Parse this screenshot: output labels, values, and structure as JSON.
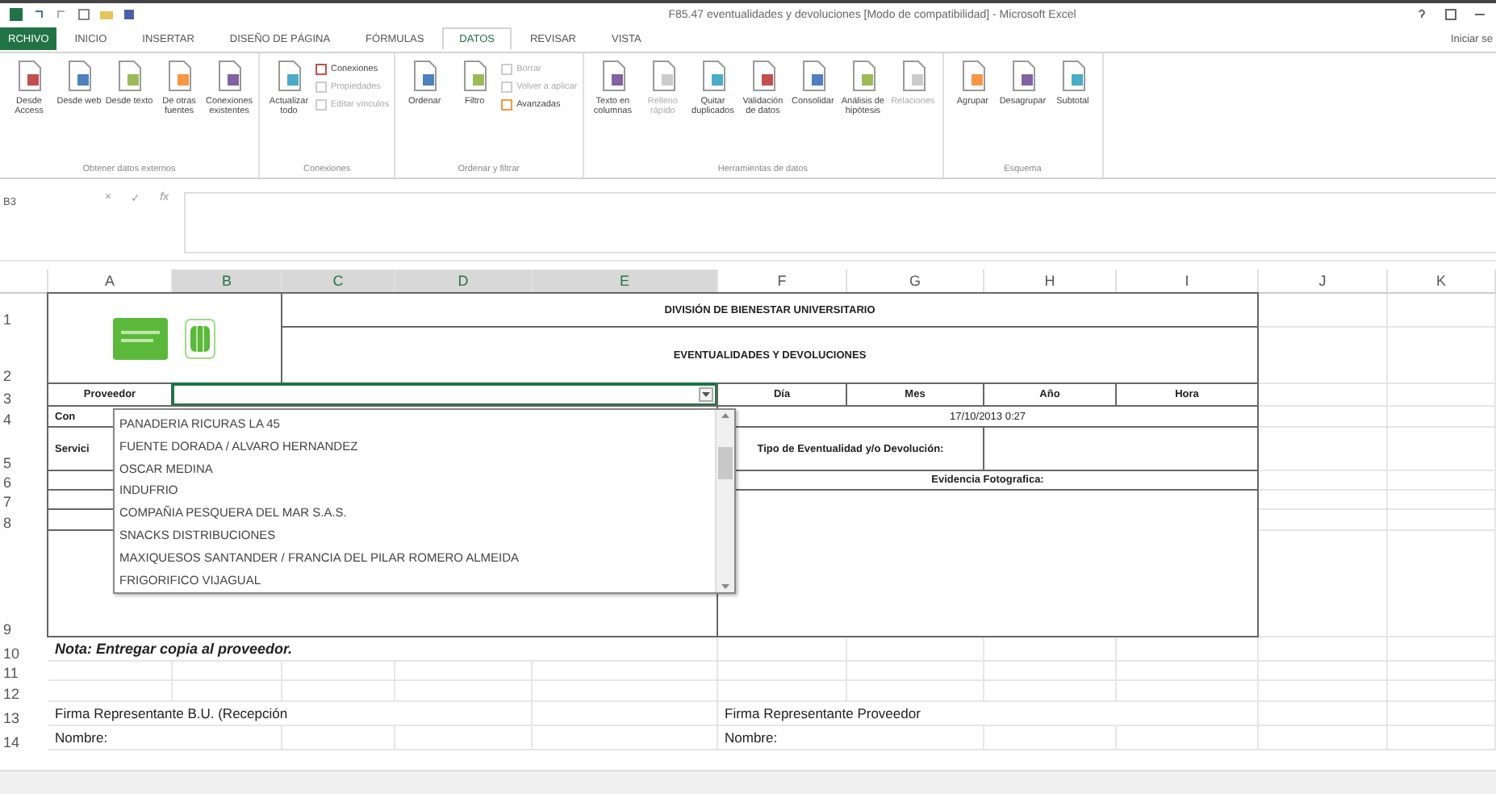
{
  "window": {
    "title": "F85.47 eventualidades y devoluciones [Modo de compatibilidad] - Microsoft Excel",
    "signin": "Iniciar se"
  },
  "tabs": [
    {
      "label": "RCHIVO",
      "kind": "file",
      "selected": false
    },
    {
      "label": "INICIO",
      "kind": "tab",
      "selected": false
    },
    {
      "label": "INSERTAR",
      "kind": "tab",
      "selected": false
    },
    {
      "label": "DISEÑO DE PÁGINA",
      "kind": "tab",
      "selected": false
    },
    {
      "label": "FÓRMULAS",
      "kind": "tab",
      "selected": false
    },
    {
      "label": "DATOS",
      "kind": "tab",
      "selected": true
    },
    {
      "label": "REVISAR",
      "kind": "tab",
      "selected": false
    },
    {
      "label": "VISTA",
      "kind": "tab",
      "selected": false
    }
  ],
  "ribbon": [
    {
      "name": "Obtener datos externos",
      "buttons": [
        {
          "label": "Desde Access",
          "kind": "large",
          "disabled": false
        },
        {
          "label": "Desde web",
          "kind": "large",
          "disabled": false
        },
        {
          "label": "Desde texto",
          "kind": "large",
          "disabled": false
        },
        {
          "label": "De otras fuentes",
          "kind": "large",
          "disabled": false
        },
        {
          "label": "Conexiones existentes",
          "kind": "large",
          "disabled": false
        }
      ]
    },
    {
      "name": "Conexiones",
      "buttons": [
        {
          "label": "Actualizar todo",
          "kind": "large",
          "disabled": false
        },
        {
          "label": "Conexiones",
          "kind": "small",
          "disabled": false
        },
        {
          "label": "Propiedades",
          "kind": "small",
          "disabled": true
        },
        {
          "label": "Editar vínculos",
          "kind": "small",
          "disabled": true
        }
      ]
    },
    {
      "name": "Ordenar y filtrar",
      "buttons": [
        {
          "label": "Ordenar",
          "kind": "large",
          "disabled": false
        },
        {
          "label": "Filtro",
          "kind": "large",
          "disabled": false
        },
        {
          "label": "Borrar",
          "kind": "small",
          "disabled": true
        },
        {
          "label": "Volver a aplicar",
          "kind": "small",
          "disabled": true
        },
        {
          "label": "Avanzadas",
          "kind": "small",
          "disabled": false
        }
      ]
    },
    {
      "name": "Herramientas de datos",
      "buttons": [
        {
          "label": "Texto en columnas",
          "kind": "large",
          "disabled": false
        },
        {
          "label": "Relleno rápido",
          "kind": "large",
          "disabled": true
        },
        {
          "label": "Quitar duplicados",
          "kind": "large",
          "disabled": false
        },
        {
          "label": "Validación de datos",
          "kind": "large",
          "disabled": false
        },
        {
          "label": "Consolidar",
          "kind": "large",
          "disabled": false
        },
        {
          "label": "Análisis de hipótesis",
          "kind": "large",
          "disabled": false
        },
        {
          "label": "Relaciones",
          "kind": "large",
          "disabled": true
        }
      ]
    },
    {
      "name": "Esquema",
      "buttons": [
        {
          "label": "Agrupar",
          "kind": "large",
          "disabled": false
        },
        {
          "label": "Desagrupar",
          "kind": "large",
          "disabled": false
        },
        {
          "label": "Subtotal",
          "kind": "large",
          "disabled": false
        }
      ]
    }
  ],
  "formula_bar": {
    "name_box": "B3",
    "buttons": [
      "×",
      "✓",
      "fx"
    ]
  },
  "columns": [
    "A",
    "B",
    "C",
    "D",
    "E",
    "F",
    "G",
    "H",
    "I",
    "J",
    "K"
  ],
  "rows": [
    "1",
    "2",
    "3",
    "4",
    "5",
    "6",
    "7",
    "8",
    "9",
    "10",
    "11",
    "12",
    "13",
    "14"
  ],
  "sheet": {
    "titles": [
      "DIVISIÓN DE BIENESTAR UNIVERSITARIO",
      "EVENTUALIDADES Y DEVOLUCIONES"
    ],
    "proveedor_label": "Proveedor",
    "date_headers": [
      "Día",
      "Mes",
      "Año",
      "Hora"
    ],
    "row4_label": "Con",
    "datetime": "17/10/2013 0:27",
    "row5_label": "Servici",
    "tipo_label": "Tipo de Eventualidad y/o Devolución:",
    "evidencia_label": "Evidencia Fotografica:",
    "note": "Nota: Entregar copia al proveedor.",
    "signatures": [
      "Firma Representante B.U. (Recepción",
      "Firma Representante Proveedor"
    ],
    "names": [
      "Nombre:",
      "Nombre:"
    ]
  },
  "dropdown": {
    "items": [
      {
        "label": "PANADERIA RICURAS LA 45",
        "selected": false
      },
      {
        "label": "FUENTE DORADA / ALVARO HERNANDEZ",
        "selected": false
      },
      {
        "label": "OSCAR MEDINA",
        "selected": false
      },
      {
        "label": "INDUFRIO",
        "selected": false
      },
      {
        "label": "COMPAÑIA PESQUERA DEL MAR S.A.S.",
        "selected": false
      },
      {
        "label": "SNACKS DISTRIBUCIONES",
        "selected": false
      },
      {
        "label": "MAXIQUESOS SANTANDER / FRANCIA DEL PILAR ROMERO ALMEIDA",
        "selected": false
      },
      {
        "label": "FRIGORIFICO VIJAGUAL",
        "selected": false
      }
    ]
  }
}
